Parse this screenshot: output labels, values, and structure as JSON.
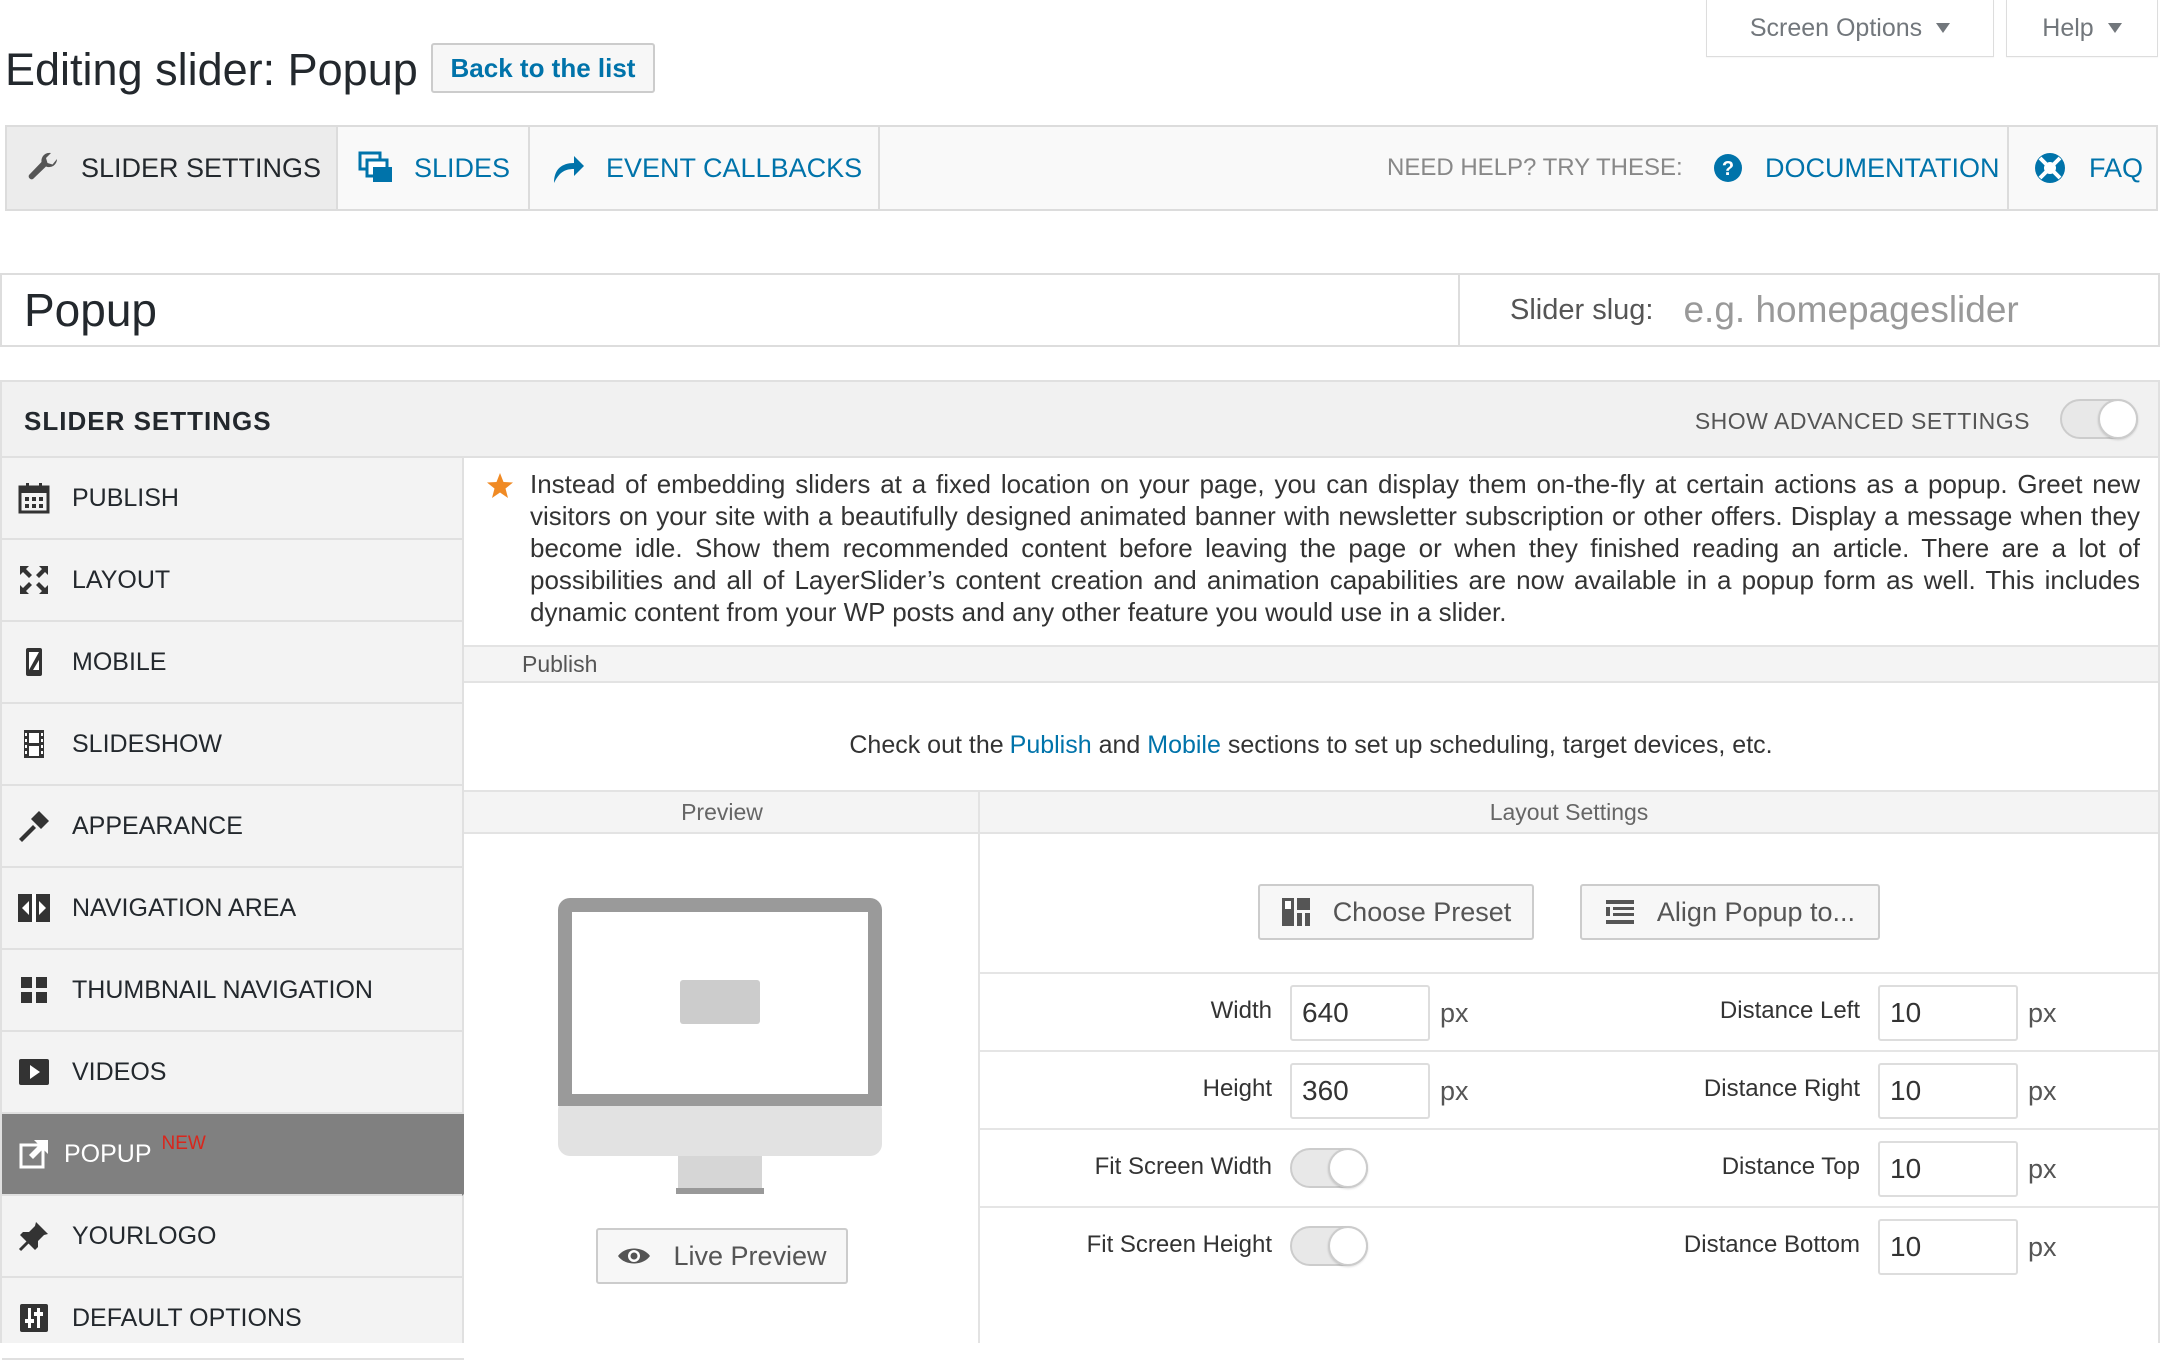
{
  "screen_options": {
    "screen_options_label": "Screen Options",
    "help_label": "Help"
  },
  "header": {
    "title": "Editing slider: Popup",
    "back_label": "Back to the list"
  },
  "mainnav": {
    "tabs": [
      {
        "label": "SLIDER SETTINGS",
        "icon": "wrench-icon"
      },
      {
        "label": "SLIDES",
        "icon": "slides-icon"
      },
      {
        "label": "EVENT CALLBACKS",
        "icon": "share-arrow-icon"
      }
    ],
    "help_text": "NEED HELP? TRY THESE:",
    "documentation_label": "DOCUMENTATION",
    "faq_label": "FAQ"
  },
  "slider": {
    "name": "Popup",
    "slug_label": "Slider slug:",
    "slug_placeholder": "e.g. homepageslider"
  },
  "settings": {
    "title": "SLIDER SETTINGS",
    "advanced_label": "SHOW ADVANCED SETTINGS",
    "sidebar": [
      {
        "label": "PUBLISH",
        "icon": "calendar-icon"
      },
      {
        "label": "LAYOUT",
        "icon": "expand-icon"
      },
      {
        "label": "MOBILE",
        "icon": "mobile-icon"
      },
      {
        "label": "SLIDESHOW",
        "icon": "film-icon"
      },
      {
        "label": "APPEARANCE",
        "icon": "hammer-icon"
      },
      {
        "label": "NAVIGATION AREA",
        "icon": "navigation-arrows-icon"
      },
      {
        "label": "THUMBNAIL NAVIGATION",
        "icon": "grid-icon"
      },
      {
        "label": "VIDEOS",
        "icon": "play-icon"
      },
      {
        "label": "POPUP",
        "icon": "external-link-icon",
        "badge": "NEW"
      },
      {
        "label": "YOURLOGO",
        "icon": "pin-icon"
      },
      {
        "label": "DEFAULT OPTIONS",
        "icon": "sliders-icon"
      }
    ]
  },
  "popup": {
    "info": "Instead of embedding sliders at a fixed location on your page, you can display them on-the-fly at certain actions as a popup. Greet new visitors on your site with a beautifully designed animated banner with newsletter subscription or other offers. Display a message when they become idle. Show them recommended content before leaving the page or when they finished reading an article. There are a lot of possibilities and all of LayerSlider’s content creation and animation capabilities are now available in a popup form as well. This includes dynamic content from your WP posts and any other feature you would use in a slider.",
    "publish_section": "Publish",
    "publish_msg_pre": "Check out the ",
    "publish_link": "Publish",
    "publish_msg_and": " and ",
    "mobile_link": "Mobile",
    "publish_msg_post": " sections to set up scheduling, target devices, etc.",
    "preview_head": "Preview",
    "layout_head": "Layout Settings",
    "live_preview": "Live Preview",
    "choose_preset": "Choose Preset",
    "align_popup": "Align Popup to...",
    "width_label": "Width",
    "width_value": "640",
    "height_label": "Height",
    "height_value": "360",
    "fit_width_label": "Fit Screen Width",
    "fit_height_label": "Fit Screen Height",
    "dist_left_label": "Distance Left",
    "dist_left_value": "10",
    "dist_right_label": "Distance Right",
    "dist_right_value": "10",
    "dist_top_label": "Distance Top",
    "dist_top_value": "10",
    "dist_bottom_label": "Distance Bottom",
    "dist_bottom_value": "10",
    "unit": "px"
  },
  "colors": {
    "link": "#0073aa",
    "active_sidebar": "#808080",
    "new_badge": "#d9261c",
    "star": "#f08a24"
  }
}
